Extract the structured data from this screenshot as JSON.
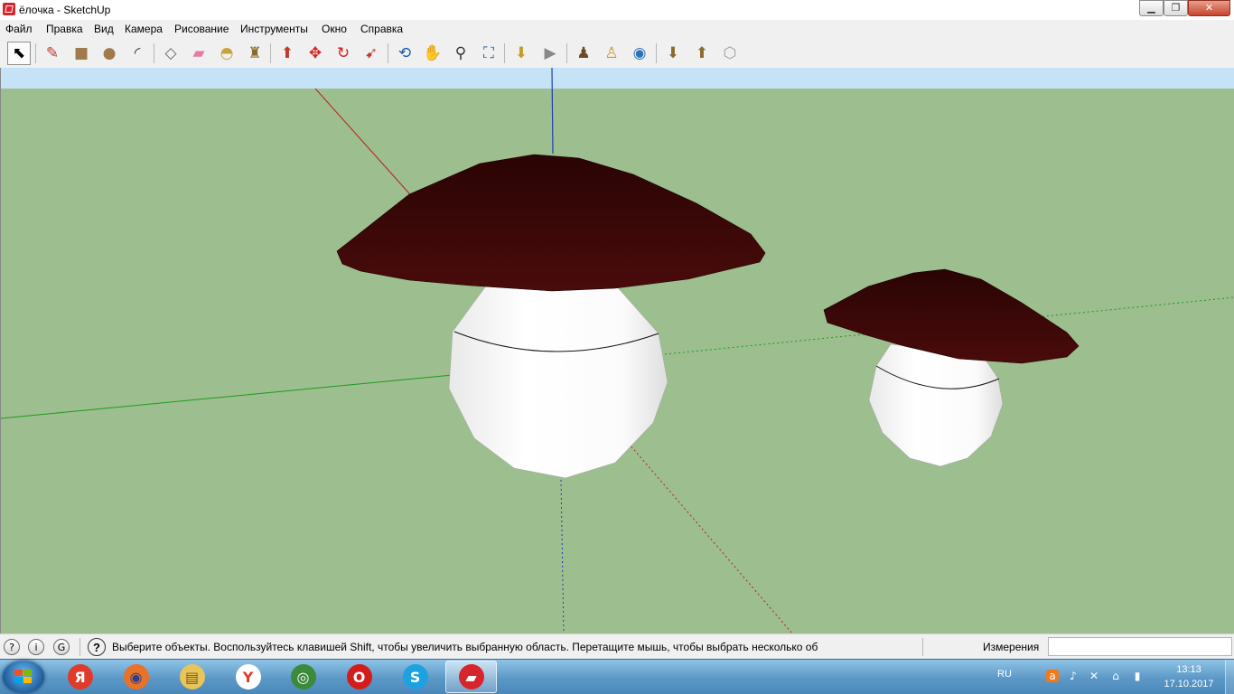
{
  "window": {
    "title": "ёлочка - SketchUp",
    "icon": "sketchup-icon",
    "controls": {
      "minimize": "minimize-icon",
      "maximize": "maximize-icon",
      "close": "close-icon"
    }
  },
  "menu": {
    "items": [
      "Файл",
      "Правка",
      "Вид",
      "Камера",
      "Рисование",
      "Инструменты",
      "Окно",
      "Справка"
    ]
  },
  "toolbar": {
    "tools": [
      {
        "name": "select-tool",
        "glyph": "⬉",
        "color": "#000000",
        "pressed": true
      },
      {
        "name": "pencil-tool",
        "glyph": "✎",
        "color": "#c0392b"
      },
      {
        "name": "rectangle-tool",
        "glyph": "■",
        "color": "#a07a4b"
      },
      {
        "name": "circle-tool",
        "glyph": "●",
        "color": "#a07a4b"
      },
      {
        "name": "arc-tool",
        "glyph": "◜",
        "color": "#333333"
      },
      {
        "name": "make-component-tool",
        "glyph": "◇",
        "color": "#666666"
      },
      {
        "name": "eraser-tool",
        "glyph": "▰",
        "color": "#e57aa6"
      },
      {
        "name": "tape-measure-tool",
        "glyph": "◓",
        "color": "#c8a23a"
      },
      {
        "name": "paint-bucket-tool",
        "glyph": "♜",
        "color": "#8a6b2e"
      },
      {
        "name": "push-pull-tool",
        "glyph": "⬆",
        "color": "#c0392b"
      },
      {
        "name": "move-tool",
        "glyph": "✥",
        "color": "#d0201e"
      },
      {
        "name": "rotate-tool",
        "glyph": "↻",
        "color": "#d0201e"
      },
      {
        "name": "follow-me-tool",
        "glyph": "➹",
        "color": "#c0392b"
      },
      {
        "name": "orbit-tool",
        "glyph": "⟲",
        "color": "#1f5fa8"
      },
      {
        "name": "pan-tool",
        "glyph": "✋",
        "color": "#555555"
      },
      {
        "name": "zoom-tool",
        "glyph": "⚲",
        "color": "#333333"
      },
      {
        "name": "zoom-extents-tool",
        "glyph": "⛶",
        "color": "#2b5d9a"
      },
      {
        "name": "previous-view-tool",
        "glyph": "⬇",
        "color": "#c89a2b"
      },
      {
        "name": "next-view-tool",
        "glyph": "▶",
        "color": "#888888"
      },
      {
        "name": "position-camera-tool",
        "glyph": "♟",
        "color": "#6b4a2a"
      },
      {
        "name": "walk-tool",
        "glyph": "♙",
        "color": "#c89a2b"
      },
      {
        "name": "look-around-tool",
        "glyph": "◉",
        "color": "#2b72b8"
      },
      {
        "name": "get-models-tool",
        "glyph": "⬇",
        "color": "#8a6b2e"
      },
      {
        "name": "share-model-tool",
        "glyph": "⬆",
        "color": "#8a6b2e"
      },
      {
        "name": "extension-warehouse-tool",
        "glyph": "⬡",
        "color": "#999999"
      }
    ]
  },
  "statusbar": {
    "icons": [
      {
        "name": "geo-location-icon",
        "glyph": "?"
      },
      {
        "name": "credits-icon",
        "glyph": "i"
      },
      {
        "name": "user-account-icon",
        "glyph": "G"
      }
    ],
    "help_icon": "?",
    "message": "Выберите объекты. Воспользуйтесь клавишей Shift, чтобы увеличить выбранную область. Перетащите мышь, чтобы выбрать несколько об",
    "measurements_label": "Измерения",
    "measurements_value": ""
  },
  "taskbar": {
    "apps": [
      {
        "name": "yandex-app",
        "glyph": "Я",
        "bg": "#e03b2a",
        "fg": "#ffffff"
      },
      {
        "name": "firefox-app",
        "glyph": "◉",
        "bg": "#e8722a",
        "fg": "#2a3f8e"
      },
      {
        "name": "explorer-app",
        "glyph": "▤",
        "bg": "#e8c45a",
        "fg": "#7a5a1a"
      },
      {
        "name": "yandex-browser-app",
        "glyph": "Y",
        "bg": "#ffffff",
        "fg": "#e03b2a"
      },
      {
        "name": "chrome-app",
        "glyph": "◎",
        "bg": "#3c8a3c",
        "fg": "#ffffff"
      },
      {
        "name": "opera-app",
        "glyph": "O",
        "bg": "#d41c1c",
        "fg": "#ffffff"
      },
      {
        "name": "skype-app",
        "glyph": "S",
        "bg": "#1ea1e0",
        "fg": "#ffffff"
      },
      {
        "name": "sketchup-app",
        "glyph": "▰",
        "bg": "#d6262c",
        "fg": "#ffffff",
        "active": true
      }
    ],
    "tray": {
      "language": "RU",
      "icons": [
        {
          "name": "avast-icon",
          "glyph": "a"
        },
        {
          "name": "volume-icon",
          "glyph": "♪"
        },
        {
          "name": "network-warning-icon",
          "glyph": "✕"
        },
        {
          "name": "usb-icon",
          "glyph": "⌂"
        },
        {
          "name": "signal-icon",
          "glyph": "▮"
        }
      ],
      "time": "13:13",
      "date": "17.10.2017"
    }
  },
  "colors": {
    "sky": "#c6e2f6",
    "ground": "#9dbe8e",
    "cap": "#3c0909",
    "stem": "#ffffff",
    "axis_red": "#b52020",
    "axis_green": "#1f9a1f",
    "axis_blue": "#1f3fb5"
  }
}
